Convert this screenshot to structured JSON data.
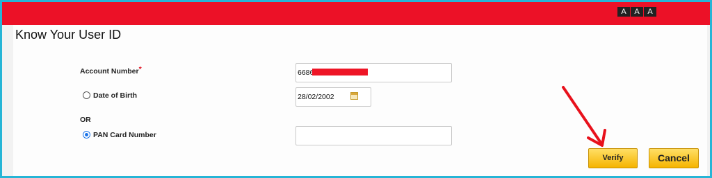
{
  "header": {
    "font_controls": [
      "A",
      "A",
      "A"
    ],
    "brand_color": "#ec1127"
  },
  "page": {
    "title": "Know Your User ID"
  },
  "form": {
    "account_number": {
      "label": "Account Number",
      "required_mark": "*",
      "value": "6686"
    },
    "date_of_birth": {
      "label": "Date of Birth",
      "value": "28/02/2002",
      "selected": false
    },
    "or_label": "OR",
    "pan_card": {
      "label": "PAN Card Number",
      "value": "",
      "selected": true
    }
  },
  "actions": {
    "verify_label": "Verify",
    "cancel_label": "Cancel",
    "accent_color": "#f5b400"
  },
  "annotation": {
    "arrow_color": "#e8111c"
  }
}
